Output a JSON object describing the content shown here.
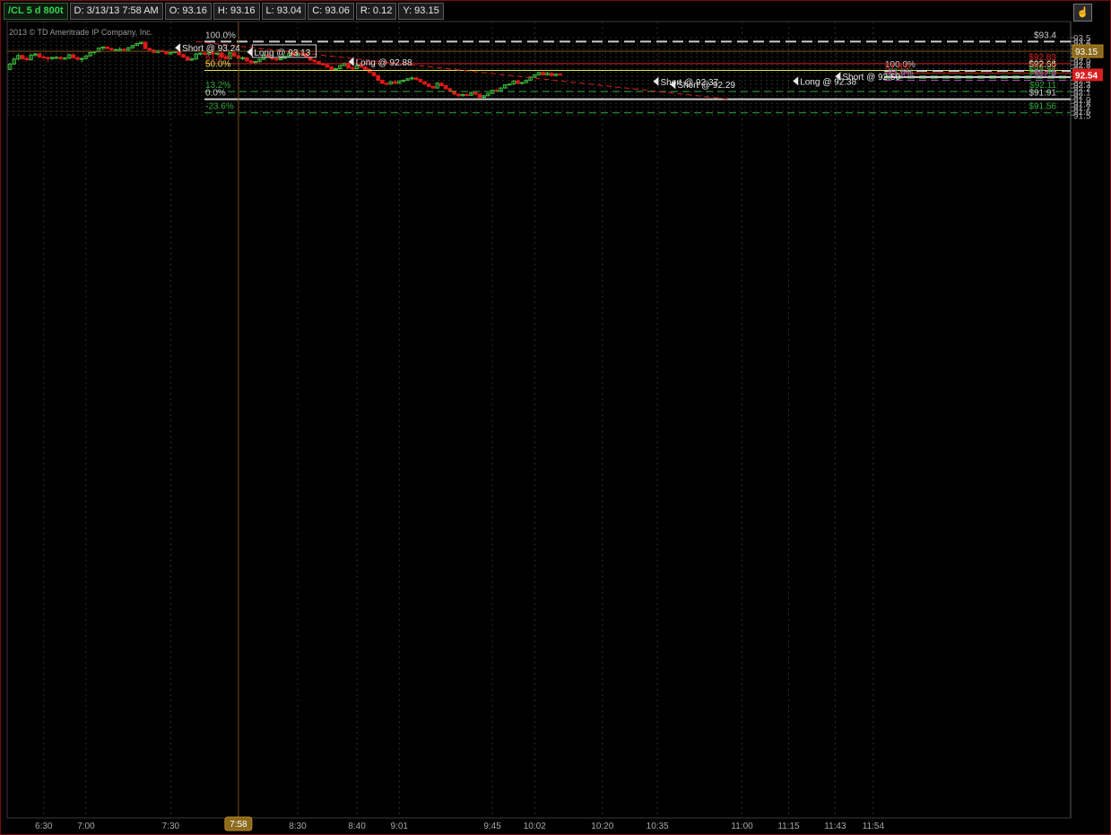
{
  "header": {
    "symbol": "/CL 5 d 800t",
    "date": "D: 3/13/13 7:58 AM",
    "open": "O: 93.16",
    "high": "H: 93.16",
    "low": "L: 93.04",
    "close": "C: 93.06",
    "range": "R: 0.12",
    "y": "Y: 93.15",
    "copyright": "2013 © TD Ameritrade IP Company, Inc."
  },
  "chart_data": {
    "type": "candlestick",
    "ylim": [
      91.47,
      93.55
    ],
    "y_ticks": [
      "93.5",
      "93.4",
      "93.3",
      "93.2",
      "93.1",
      "93",
      "92.9",
      "92.8",
      "92.7",
      "92.6",
      "92.5",
      "92.4",
      "92.3",
      "92.2",
      "92.1",
      "92",
      "91.9",
      "91.8",
      "91.7",
      "91.6",
      "91.5"
    ],
    "x_labels": [
      {
        "label": "6:30",
        "bar": 8
      },
      {
        "label": "7:00",
        "bar": 18
      },
      {
        "label": "7:30",
        "bar": 38
      },
      {
        "label": "7:58",
        "bar": 54,
        "highlight": true
      },
      {
        "label": "8:30",
        "bar": 68
      },
      {
        "label": "8:40",
        "bar": 82
      },
      {
        "label": "9:01",
        "bar": 92
      },
      {
        "label": "9:45",
        "bar": 114
      },
      {
        "label": "10:02",
        "bar": 124
      },
      {
        "label": "10:20",
        "bar": 140
      },
      {
        "label": "10:35",
        "bar": 153
      },
      {
        "label": "11:00",
        "bar": 173
      },
      {
        "label": "11:15",
        "bar": 184
      },
      {
        "label": "11:43",
        "bar": 195
      },
      {
        "label": "11:54",
        "bar": 204
      }
    ],
    "current_price": {
      "label": "92.54",
      "value": 92.54,
      "color": "#d81f1f"
    },
    "crosshair": {
      "label": "93.15",
      "value": 93.15,
      "bar": 54,
      "color": "#c08a20"
    },
    "candles": [
      [
        92.68,
        92.85,
        92.66,
        92.82
      ],
      [
        92.82,
        92.98,
        92.8,
        92.95
      ],
      [
        92.95,
        93.08,
        92.92,
        93.04
      ],
      [
        93.04,
        93.06,
        92.92,
        92.96
      ],
      [
        92.96,
        93.02,
        92.9,
        92.93
      ],
      [
        92.93,
        93.08,
        92.91,
        93.05
      ],
      [
        93.05,
        93.1,
        93.02,
        93.08
      ],
      [
        93.08,
        93.1,
        92.98,
        93.0
      ],
      [
        93.0,
        93.04,
        92.96,
        92.98
      ],
      [
        92.98,
        93.02,
        92.88,
        92.96
      ],
      [
        92.96,
        93.01,
        92.92,
        92.99
      ],
      [
        92.99,
        93.03,
        92.95,
        92.99
      ],
      [
        92.99,
        93.02,
        92.92,
        92.96
      ],
      [
        92.96,
        93.0,
        92.93,
        92.97
      ],
      [
        92.97,
        93.08,
        92.95,
        93.06
      ],
      [
        93.06,
        93.08,
        92.96,
        92.98
      ],
      [
        92.98,
        93.02,
        92.92,
        92.94
      ],
      [
        92.94,
        93.0,
        92.86,
        92.96
      ],
      [
        92.96,
        93.04,
        92.94,
        93.03
      ],
      [
        93.03,
        93.14,
        93.01,
        93.12
      ],
      [
        93.12,
        93.15,
        93.06,
        93.14
      ],
      [
        93.14,
        93.25,
        93.12,
        93.23
      ],
      [
        93.23,
        93.28,
        93.18,
        93.26
      ],
      [
        93.26,
        93.28,
        93.2,
        93.22
      ],
      [
        93.22,
        93.25,
        93.16,
        93.19
      ],
      [
        93.19,
        93.22,
        93.14,
        93.19
      ],
      [
        93.19,
        93.26,
        93.16,
        93.2
      ],
      [
        93.2,
        93.23,
        93.15,
        93.18
      ],
      [
        93.18,
        93.26,
        93.15,
        93.24
      ],
      [
        93.24,
        93.32,
        93.21,
        93.3
      ],
      [
        93.3,
        93.37,
        93.28,
        93.35
      ],
      [
        93.35,
        93.4,
        93.32,
        93.38
      ],
      [
        93.38,
        93.4,
        93.2,
        93.22
      ],
      [
        93.22,
        93.24,
        93.16,
        93.18
      ],
      [
        93.18,
        93.2,
        93.1,
        93.12
      ],
      [
        93.12,
        93.18,
        93.1,
        93.16
      ],
      [
        93.16,
        93.2,
        93.12,
        93.14
      ],
      [
        93.14,
        93.16,
        93.07,
        93.08
      ],
      [
        93.08,
        93.15,
        93.06,
        93.12
      ],
      [
        93.12,
        93.16,
        93.1,
        93.14
      ],
      [
        93.14,
        93.16,
        93.04,
        93.06
      ],
      [
        93.06,
        93.09,
        92.97,
        93.0
      ],
      [
        93.0,
        93.03,
        92.9,
        92.92
      ],
      [
        92.92,
        92.98,
        92.9,
        92.95
      ],
      [
        92.95,
        93.1,
        92.93,
        93.08
      ],
      [
        93.08,
        93.12,
        93.04,
        93.1
      ],
      [
        93.1,
        93.14,
        93.05,
        93.07
      ],
      [
        93.07,
        93.12,
        93.03,
        93.11
      ],
      [
        93.11,
        93.15,
        93.06,
        93.08
      ],
      [
        93.08,
        93.12,
        93.04,
        93.1
      ],
      [
        93.1,
        93.14,
        92.98,
        93.0
      ],
      [
        93.0,
        93.04,
        92.93,
        92.96
      ],
      [
        92.96,
        93.13,
        92.94,
        93.11
      ],
      [
        93.11,
        93.13,
        93.01,
        93.03
      ],
      [
        93.03,
        93.06,
        92.95,
        92.97
      ],
      [
        92.97,
        93.02,
        92.92,
        92.98
      ],
      [
        92.98,
        93.0,
        92.88,
        92.9
      ],
      [
        92.9,
        92.94,
        92.84,
        92.86
      ],
      [
        92.86,
        92.9,
        92.84,
        92.88
      ],
      [
        92.88,
        92.96,
        92.86,
        92.94
      ],
      [
        92.94,
        93.06,
        92.92,
        93.05
      ],
      [
        93.05,
        93.08,
        92.97,
        92.99
      ],
      [
        92.99,
        93.02,
        92.92,
        92.95
      ],
      [
        92.95,
        92.99,
        92.9,
        92.93
      ],
      [
        92.93,
        92.98,
        92.91,
        92.97
      ],
      [
        92.97,
        93.04,
        92.95,
        93.02
      ],
      [
        93.02,
        93.14,
        93.0,
        93.1
      ],
      [
        93.1,
        93.13,
        93.02,
        93.04
      ],
      [
        93.04,
        93.12,
        93.02,
        93.09
      ],
      [
        93.09,
        93.14,
        93.06,
        93.08
      ],
      [
        93.08,
        93.1,
        92.98,
        93.0
      ],
      [
        93.0,
        93.02,
        92.9,
        92.92
      ],
      [
        92.92,
        92.94,
        92.86,
        92.88
      ],
      [
        92.88,
        92.9,
        92.8,
        92.82
      ],
      [
        92.82,
        92.86,
        92.78,
        92.8
      ],
      [
        92.8,
        92.83,
        92.72,
        92.74
      ],
      [
        92.74,
        92.76,
        92.66,
        92.68
      ],
      [
        92.68,
        92.72,
        92.64,
        92.7
      ],
      [
        92.7,
        92.8,
        92.68,
        92.78
      ],
      [
        92.78,
        92.86,
        92.76,
        92.84
      ],
      [
        92.84,
        92.86,
        92.7,
        92.72
      ],
      [
        92.72,
        92.76,
        92.66,
        92.7
      ],
      [
        92.7,
        92.8,
        92.68,
        92.78
      ],
      [
        92.78,
        92.82,
        92.72,
        92.74
      ],
      [
        92.74,
        92.76,
        92.66,
        92.68
      ],
      [
        92.68,
        92.7,
        92.58,
        92.6
      ],
      [
        92.6,
        92.62,
        92.5,
        92.52
      ],
      [
        92.52,
        92.54,
        92.38,
        92.4
      ],
      [
        92.4,
        92.42,
        92.3,
        92.32
      ],
      [
        92.32,
        92.36,
        92.26,
        92.3
      ],
      [
        92.3,
        92.38,
        92.28,
        92.36
      ],
      [
        92.36,
        92.4,
        92.3,
        92.32
      ],
      [
        92.32,
        92.4,
        92.3,
        92.38
      ],
      [
        92.38,
        92.42,
        92.34,
        92.4
      ],
      [
        92.4,
        92.46,
        92.38,
        92.44
      ],
      [
        92.44,
        92.5,
        92.4,
        92.46
      ],
      [
        92.46,
        92.48,
        92.4,
        92.42
      ],
      [
        92.42,
        92.44,
        92.34,
        92.36
      ],
      [
        92.36,
        92.38,
        92.28,
        92.3
      ],
      [
        92.3,
        92.32,
        92.22,
        92.24
      ],
      [
        92.24,
        92.26,
        92.18,
        92.2
      ],
      [
        92.2,
        92.36,
        92.18,
        92.32
      ],
      [
        92.32,
        92.36,
        92.24,
        92.26
      ],
      [
        92.26,
        92.28,
        92.16,
        92.18
      ],
      [
        92.18,
        92.2,
        92.1,
        92.12
      ],
      [
        92.12,
        92.14,
        92.02,
        92.04
      ],
      [
        92.04,
        92.06,
        91.96,
        92.0
      ],
      [
        92.0,
        92.06,
        91.98,
        92.03
      ],
      [
        92.03,
        92.06,
        91.98,
        92.01
      ],
      [
        92.01,
        92.1,
        92.0,
        92.08
      ],
      [
        92.08,
        92.12,
        92.02,
        92.04
      ],
      [
        92.04,
        92.06,
        91.94,
        91.96
      ],
      [
        91.96,
        92.02,
        91.91,
        92.0
      ],
      [
        92.0,
        92.08,
        91.98,
        92.06
      ],
      [
        92.06,
        92.16,
        92.04,
        92.14
      ],
      [
        92.14,
        92.18,
        92.1,
        92.12
      ],
      [
        92.12,
        92.22,
        92.1,
        92.2
      ],
      [
        92.2,
        92.3,
        92.18,
        92.28
      ],
      [
        92.28,
        92.32,
        92.26,
        92.3
      ],
      [
        92.3,
        92.4,
        92.28,
        92.38
      ],
      [
        92.38,
        92.42,
        92.3,
        92.32
      ],
      [
        92.32,
        92.36,
        92.28,
        92.34
      ],
      [
        92.34,
        92.42,
        92.32,
        92.4
      ],
      [
        92.4,
        92.5,
        92.38,
        92.48
      ],
      [
        92.48,
        92.56,
        92.46,
        92.54
      ],
      [
        92.54,
        92.62,
        92.52,
        92.6
      ],
      [
        92.6,
        92.62,
        92.52,
        92.54
      ],
      [
        92.54,
        92.62,
        92.52,
        92.58
      ],
      [
        92.58,
        92.6,
        92.5,
        92.52
      ],
      [
        92.52,
        92.58,
        92.5,
        92.56
      ],
      [
        92.56,
        92.58,
        92.52,
        92.54
      ]
    ],
    "fibs_main": [
      {
        "left": "100.0%",
        "right": "$93.4",
        "value": 93.4,
        "color": "#cccccc",
        "style": "dash"
      },
      {
        "left": "61.8%",
        "right": "$92.83",
        "value": 92.83,
        "color": "#d81f1f",
        "style": "solid"
      },
      {
        "left": "50.0%",
        "right": "$92.66",
        "value": 92.655,
        "color": "#e6e64a",
        "style": "solid"
      },
      {
        "left": "13.2%",
        "right": "$92.11",
        "value": 92.11,
        "color": "#2fa83a",
        "style": "dash"
      },
      {
        "left": "0.0%",
        "right": "$91.91",
        "value": 91.91,
        "color": "#cccccc",
        "style": "solid"
      },
      {
        "left": "-23.6%",
        "right": "$91.56",
        "value": 91.56,
        "color": "#2fa83a",
        "style": "dash"
      }
    ],
    "fibs_small": [
      {
        "left": "100.0%",
        "right": "$92.64",
        "value": 92.64,
        "color": "#cccccc",
        "style": "dash"
      },
      {
        "left": "61.8%",
        "right": "$92.58",
        "value": 92.58,
        "color": "#d81f1f",
        "style": "solid"
      },
      {
        "left": "",
        "right": "$92.51",
        "value": 92.51,
        "color": "#2fa83a",
        "style": "dash"
      },
      {
        "left": "",
        "right": "",
        "value": 92.48,
        "color": "#cccccc",
        "style": "solid"
      },
      {
        "left": "-23.6%",
        "right": "$92.45",
        "value": 92.45,
        "color": "#2fa83a",
        "style": "dash"
      },
      {
        "left": "-61.8%",
        "right": "$92.4",
        "value": 92.4,
        "color": "#c040c0",
        "style": "dash"
      }
    ],
    "trades": [
      {
        "label": "Short @ 93.24",
        "bar": 39,
        "price": 93.24
      },
      {
        "label": "Long @ 93.13",
        "bar": 56,
        "price": 93.13,
        "boxed": true
      },
      {
        "label": "Long @ 92.88",
        "bar": 80,
        "price": 92.88
      },
      {
        "label": "Short @ 92.37",
        "bar": 152,
        "price": 92.37
      },
      {
        "label": "Short @ 92.29",
        "bar": 156,
        "price": 92.29
      },
      {
        "label": "Long @ 92.38",
        "bar": 185,
        "price": 92.38
      },
      {
        "label": "Short @ 92.50",
        "bar": 195,
        "price": 92.5
      }
    ],
    "trendline": {
      "bar1": 44,
      "price1": 93.4,
      "bar2": 170,
      "price2": 91.91,
      "color": "#d81f1f"
    }
  }
}
